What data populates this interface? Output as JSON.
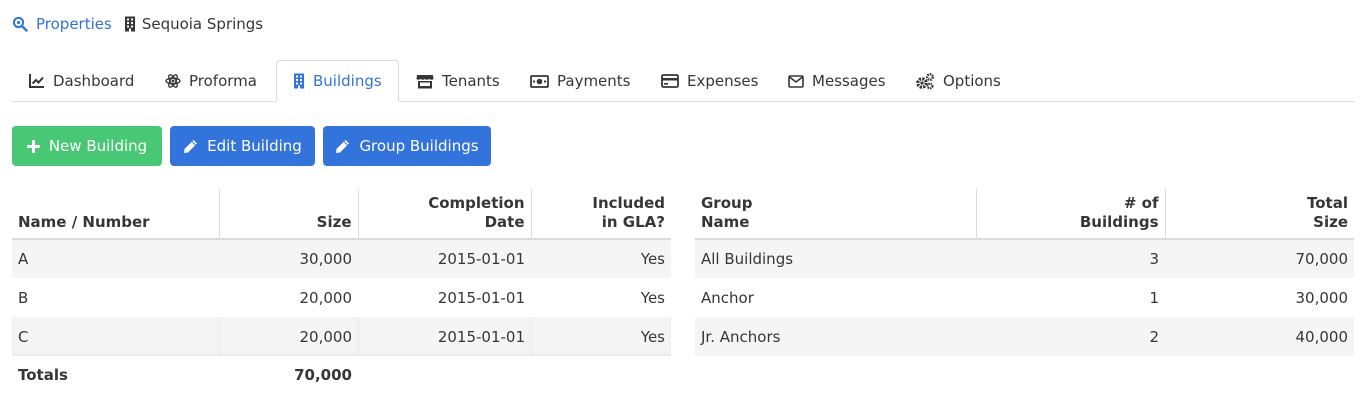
{
  "breadcrumb": {
    "properties_label": "Properties",
    "current_label": "Sequoia Springs"
  },
  "tabs": [
    {
      "label": "Dashboard",
      "icon": "chart-line-icon"
    },
    {
      "label": "Proforma",
      "icon": "atom-icon"
    },
    {
      "label": "Buildings",
      "icon": "building-icon",
      "active": true
    },
    {
      "label": "Tenants",
      "icon": "store-icon"
    },
    {
      "label": "Payments",
      "icon": "money-bill-icon"
    },
    {
      "label": "Expenses",
      "icon": "credit-card-icon"
    },
    {
      "label": "Messages",
      "icon": "envelope-icon"
    },
    {
      "label": "Options",
      "icon": "cogs-icon"
    }
  ],
  "toolbar": {
    "new_building": "New Building",
    "edit_building": "Edit Building",
    "group_buildings": "Group Buildings"
  },
  "colors": {
    "accent": "#3273dc",
    "success": "#48c774"
  },
  "buildings_table": {
    "headers": {
      "name": "Name / Number",
      "size": "Size",
      "completion_line1": "Completion",
      "completion_line2": "Date",
      "gla_line1": "Included",
      "gla_line2": "in GLA?"
    },
    "rows": [
      {
        "name": "A",
        "size": "30,000",
        "date": "2015-01-01",
        "gla": "Yes"
      },
      {
        "name": "B",
        "size": "20,000",
        "date": "2015-01-01",
        "gla": "Yes"
      },
      {
        "name": "C",
        "size": "20,000",
        "date": "2015-01-01",
        "gla": "Yes"
      }
    ],
    "totals": {
      "label": "Totals",
      "size": "70,000"
    }
  },
  "groups_table": {
    "headers": {
      "group_line1": "Group",
      "group_line2": "Name",
      "count_line1": "# of",
      "count_line2": "Buildings",
      "total_line1": "Total",
      "total_line2": "Size"
    },
    "rows": [
      {
        "name": "All Buildings",
        "count": "3",
        "size": "70,000"
      },
      {
        "name": "Anchor",
        "count": "1",
        "size": "30,000"
      },
      {
        "name": "Jr. Anchors",
        "count": "2",
        "size": "40,000"
      }
    ]
  }
}
